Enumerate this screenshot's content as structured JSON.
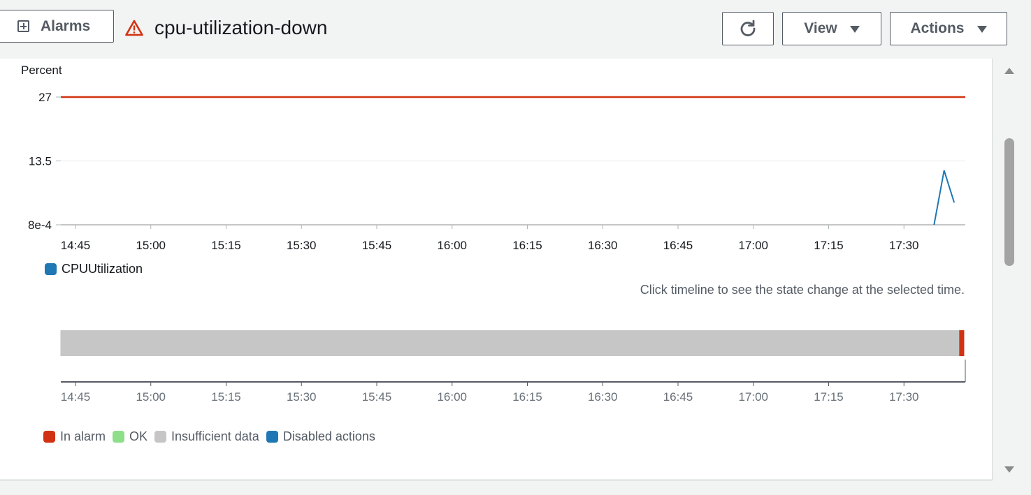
{
  "header": {
    "alarms_button": "Alarms",
    "alarm_name": "cpu-utilization-down",
    "view_button": "View",
    "actions_button": "Actions",
    "icons": {
      "add": "plus-square-icon",
      "warning": "warning-triangle-icon",
      "refresh": "refresh-icon",
      "caret": "caret-down-icon"
    }
  },
  "chart_data": {
    "type": "line",
    "ylabel": "Percent",
    "y_ticks": [
      "27",
      "13.5",
      "8e-4"
    ],
    "ylim": [
      0.0008,
      27
    ],
    "x_ticks": [
      "14:45",
      "15:00",
      "15:15",
      "15:30",
      "15:45",
      "16:00",
      "16:15",
      "16:30",
      "16:45",
      "17:00",
      "17:15",
      "17:30"
    ],
    "threshold": {
      "value": 27,
      "color": "#d13212"
    },
    "series": [
      {
        "name": "CPUUtilization",
        "color": "#1f77b4",
        "points": [
          {
            "x": "17:36",
            "y": 0.0008
          },
          {
            "x": "17:38",
            "y": 11.5
          },
          {
            "x": "17:40",
            "y": 4.7
          }
        ]
      }
    ]
  },
  "timeline": {
    "hint": "Click timeline to see the state change at the selected time.",
    "x_ticks": [
      "14:45",
      "15:00",
      "15:15",
      "15:30",
      "15:45",
      "16:00",
      "16:15",
      "16:30",
      "16:45",
      "17:00",
      "17:15",
      "17:30"
    ],
    "states": [
      {
        "state": "Insufficient data",
        "from": "14:42",
        "to": "17:41"
      },
      {
        "state": "In alarm",
        "from": "17:41",
        "to": "17:42"
      }
    ],
    "legend": [
      {
        "label": "In alarm",
        "color": "#d13212"
      },
      {
        "label": "OK",
        "color": "#8fde8a"
      },
      {
        "label": "Insufficient data",
        "color": "#c6c6c6"
      },
      {
        "label": "Disabled actions",
        "color": "#1f77b4"
      }
    ]
  }
}
